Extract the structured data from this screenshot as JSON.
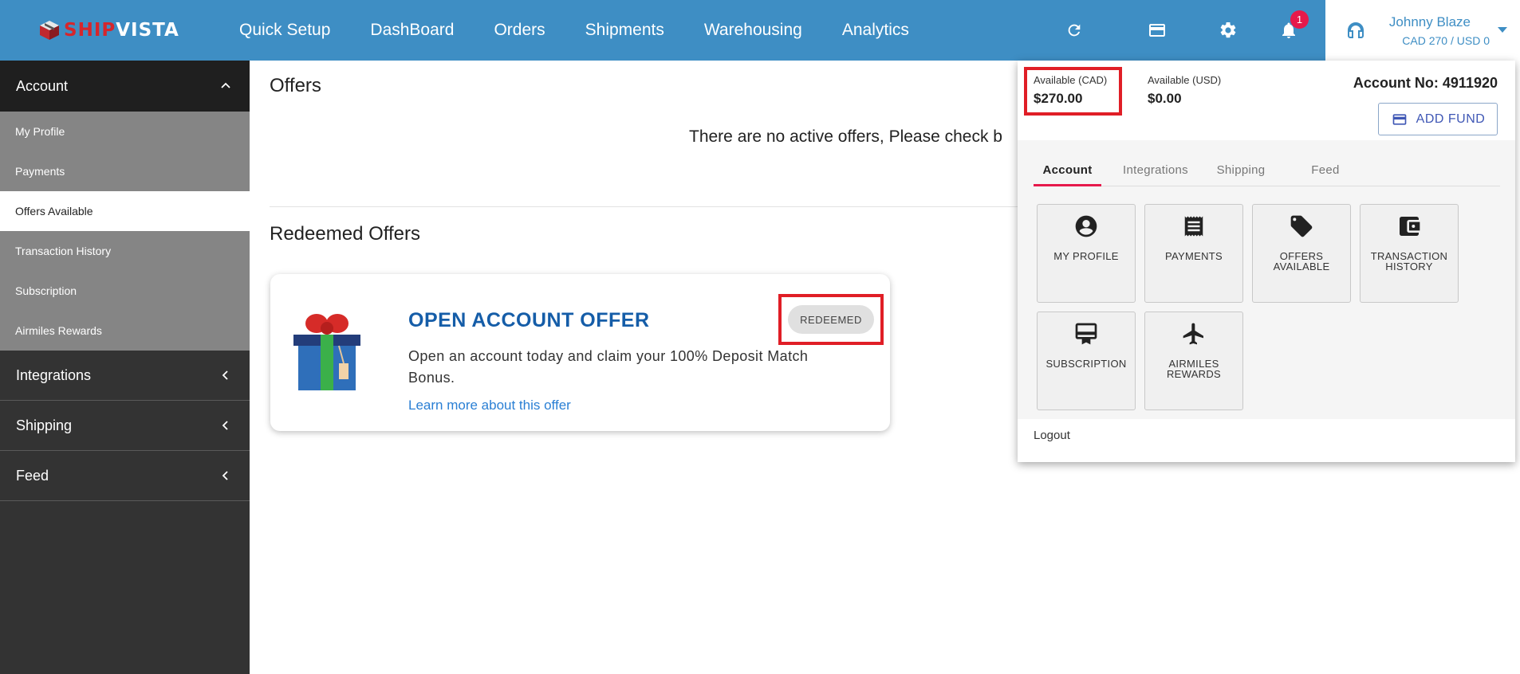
{
  "brand": {
    "part1": "SHIP",
    "part2": "VISTA"
  },
  "nav": [
    "Quick Setup",
    "DashBoard",
    "Orders",
    "Shipments",
    "Warehousing",
    "Analytics"
  ],
  "header": {
    "notification_count": "1",
    "user_name": "Johnny Blaze",
    "user_balance": "CAD 270 / USD 0"
  },
  "sidebar": {
    "account_label": "Account",
    "account_items": [
      "My Profile",
      "Payments",
      "Offers Available",
      "Transaction History",
      "Subscription",
      "Airmiles Rewards"
    ],
    "active_item": "Offers Available",
    "sections": [
      "Integrations",
      "Shipping",
      "Feed"
    ]
  },
  "main": {
    "title": "Offers",
    "no_offers_text": "There are no active offers, Please check b",
    "redeemed_title": "Redeemed Offers",
    "offer": {
      "title": "OPEN ACCOUNT OFFER",
      "description": "Open an account today and claim your 100% Deposit Match Bonus.",
      "link": "Learn more about this offer",
      "status": "REDEEMED"
    }
  },
  "panel": {
    "cad_label": "Available (CAD)",
    "cad_value": "$270.00",
    "usd_label": "Available (USD)",
    "usd_value": "$0.00",
    "account_no": "Account No: 4911920",
    "add_fund": "ADD FUND",
    "tabs": [
      "Account",
      "Integrations",
      "Shipping",
      "Feed"
    ],
    "tiles": [
      "MY PROFILE",
      "PAYMENTS",
      "OFFERS AVAILABLE",
      "TRANSACTION HISTORY",
      "SUBSCRIPTION",
      "AIRMILES REWARDS"
    ],
    "logout": "Logout"
  },
  "colors": {
    "topbar": "#3e8ec4",
    "sidebar": "#333333",
    "accent_red": "#e01e26",
    "offer_title": "#155da8",
    "tab_underline": "#e6194b"
  }
}
